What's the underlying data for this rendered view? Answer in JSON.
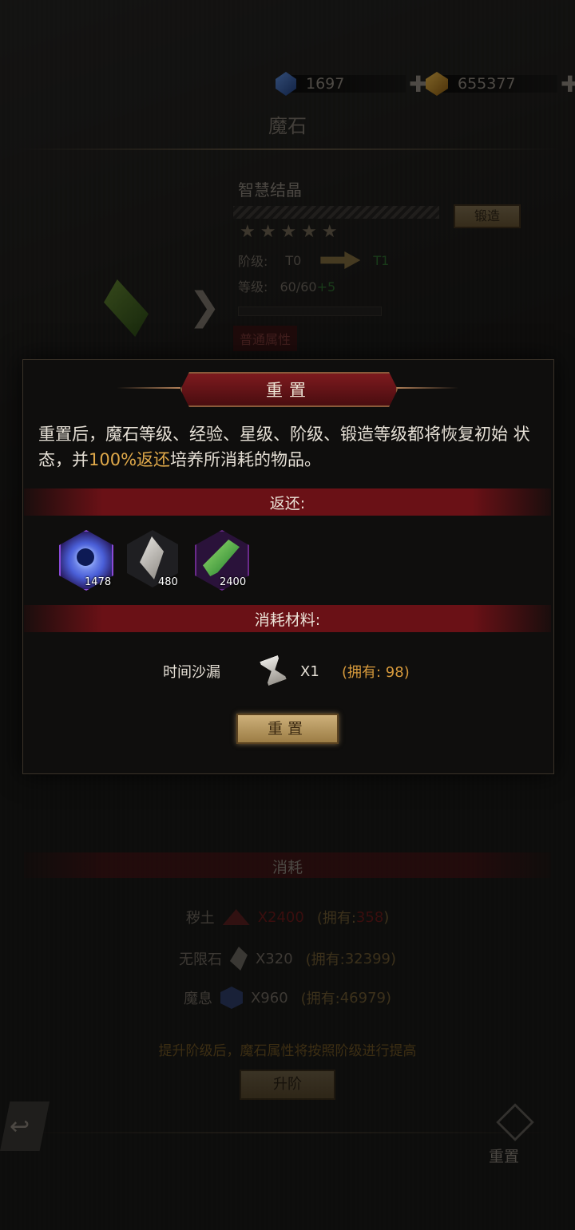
{
  "currencies": [
    {
      "icon": "blue-gem-icon",
      "value": "1697"
    },
    {
      "icon": "gold-gem-icon",
      "value": "655377"
    }
  ],
  "page_title": "魔石",
  "stone": {
    "name": "智慧结晶",
    "forge_label": "锻造",
    "stars": "★★★★★",
    "tier_label": "阶级:",
    "tier_from": "T0",
    "tier_to": "T1",
    "level_label": "等级:",
    "level_value": "60/60",
    "level_bonus": "+5",
    "attr_tab": "普通属性"
  },
  "dialog": {
    "title": "重置",
    "desc_part1": "重置后，魔石等级、经验、星级、阶级、锻造等级都将恢复初始 状态，并",
    "desc_highlight": "100%返还",
    "desc_part2": "培养所消耗的物品。",
    "return_header": "返还:",
    "return_items": [
      {
        "icon": "blue-orb-icon",
        "count": "1478"
      },
      {
        "icon": "silver-crystal-icon",
        "count": "480"
      },
      {
        "icon": "green-leaf-icon",
        "count": "2400"
      }
    ],
    "cost_header": "消耗材料:",
    "material": {
      "name": "时间沙漏",
      "icon": "hourglass-icon",
      "qty": "X1",
      "own": "(拥有: 98)"
    },
    "confirm_label": "重置"
  },
  "background_cost": {
    "header": "消耗",
    "rows": [
      {
        "name": "秽土",
        "qty": "X2400",
        "own_prefix": "(拥有: ",
        "own_value": "358",
        "own_suffix": ")"
      },
      {
        "name": "无限石",
        "qty": "X320",
        "own_prefix": "(拥有: ",
        "own_value": "32399",
        "own_suffix": ")"
      },
      {
        "name": "魔息",
        "qty": "X960",
        "own_prefix": "(拥有: ",
        "own_value": "46979",
        "own_suffix": ")"
      }
    ],
    "hint": "提升阶级后，魔石属性将按照阶级进行提高",
    "upgrade_label": "升阶",
    "reset_corner_label": "重置"
  }
}
